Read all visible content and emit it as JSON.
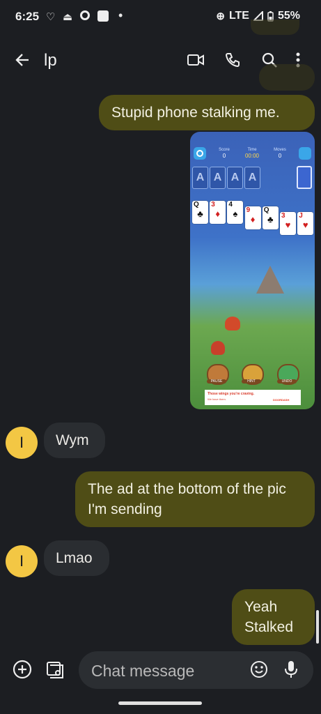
{
  "status_bar": {
    "time": "6:25",
    "network": "LTE",
    "battery": "55%"
  },
  "header": {
    "contact_name": "lp",
    "icons": [
      "back-arrow-icon",
      "video-call-icon",
      "phone-icon",
      "search-icon",
      "more-vert-icon"
    ]
  },
  "messages": [
    {
      "direction": "outgoing",
      "text": "Stupid phone stalking me."
    },
    {
      "direction": "outgoing",
      "type": "image",
      "content": "solitaire-screenshot"
    },
    {
      "direction": "incoming",
      "avatar_initial": "I",
      "text": "Wym"
    },
    {
      "direction": "outgoing",
      "text": "The ad at the bottom of the pic I'm sending"
    },
    {
      "direction": "incoming",
      "avatar_initial": "I",
      "text": "Lmao"
    },
    {
      "direction": "outgoing",
      "text_line1": "Yeah",
      "text_line2": "Stalked"
    }
  ],
  "game_screenshot": {
    "labels": {
      "score": "Score",
      "time": "Time",
      "moves": "Moves"
    },
    "values": {
      "score": "0",
      "time": "00:00",
      "moves": "0"
    },
    "foundation": [
      "A",
      "A",
      "A",
      "A"
    ],
    "tableau": [
      {
        "rank": "Q",
        "suit": "♣",
        "color": "blk"
      },
      {
        "rank": "3",
        "suit": "♦",
        "color": "red"
      },
      {
        "rank": "4",
        "suit": "♠",
        "color": "blk"
      },
      {
        "rank": "9",
        "suit": "♦",
        "color": "red"
      },
      {
        "rank": "Q",
        "suit": "♣",
        "color": "blk"
      },
      {
        "rank": "3",
        "suit": "♥",
        "color": "red"
      },
      {
        "rank": "J",
        "suit": "♥",
        "color": "red"
      }
    ],
    "buttons": [
      "PAUSE",
      "HINT",
      "UNDO"
    ],
    "ad_line1": "Those wings you're craving.",
    "ad_line2": "We have them.",
    "ad_brand": "DOORDASH"
  },
  "composer": {
    "placeholder": "Chat message"
  },
  "colors": {
    "background": "#1c1e22",
    "outgoing_bubble": "#4f4d16",
    "incoming_bubble": "#2a2d31",
    "avatar": "#f3c744"
  }
}
